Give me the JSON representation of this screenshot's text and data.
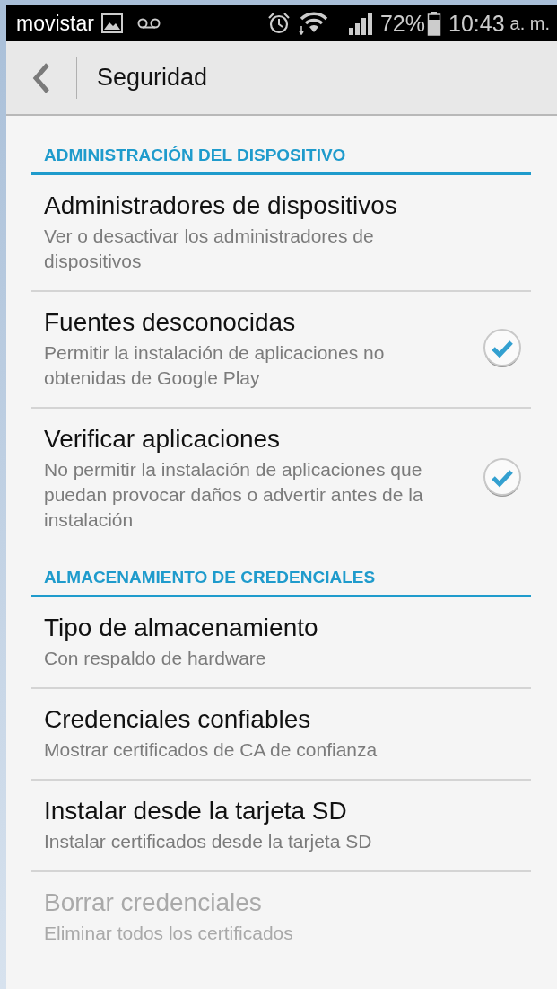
{
  "status_bar": {
    "carrier": "movistar",
    "battery": "72%",
    "time": "10:43",
    "ampm": "a. m."
  },
  "action_bar": {
    "title": "Seguridad"
  },
  "sections": [
    {
      "header": "ADMINISTRACIÓN DEL DISPOSITIVO",
      "items": [
        {
          "kind": "plain",
          "title": "Administradores de dispositivos",
          "summary": "Ver o desactivar los administradores de dispositivos",
          "disabled": false
        },
        {
          "kind": "checkbox",
          "title": "Fuentes desconocidas",
          "summary": "Permitir la instalación de aplicaciones no obtenidas de Google Play",
          "checked": true,
          "disabled": false
        },
        {
          "kind": "checkbox",
          "title": "Verificar aplicaciones",
          "summary": "No permitir la instalación de aplicaciones que puedan provocar daños o advertir antes de la instalación",
          "checked": true,
          "disabled": false
        }
      ]
    },
    {
      "header": "ALMACENAMIENTO DE CREDENCIALES",
      "items": [
        {
          "kind": "plain",
          "title": "Tipo de almacenamiento",
          "summary": "Con respaldo de hardware",
          "disabled": false
        },
        {
          "kind": "plain",
          "title": "Credenciales confiables",
          "summary": "Mostrar certificados de CA de confianza",
          "disabled": false
        },
        {
          "kind": "plain",
          "title": "Instalar desde la tarjeta SD",
          "summary": "Instalar certificados desde la tarjeta SD",
          "disabled": false
        },
        {
          "kind": "plain",
          "title": "Borrar credenciales",
          "summary": "Eliminar todos los certificados",
          "disabled": true
        }
      ]
    }
  ]
}
